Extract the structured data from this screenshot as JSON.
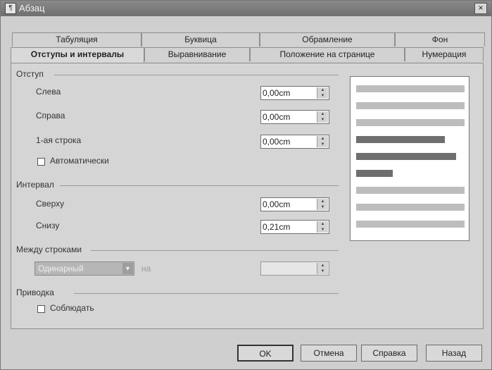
{
  "window": {
    "title": "Абзац",
    "close_glyph": "×"
  },
  "tabs_top": [
    {
      "label": "Табуляция"
    },
    {
      "label": "Буквица"
    },
    {
      "label": "Обрамление"
    },
    {
      "label": "Фон"
    }
  ],
  "tabs_bottom": [
    {
      "label": "Отступы и интервалы"
    },
    {
      "label": "Выравнивание"
    },
    {
      "label": "Положение на странице"
    },
    {
      "label": "Нумерация"
    }
  ],
  "indent": {
    "heading": "Отступ",
    "left_label": "Слева",
    "left_value": "0,00cm",
    "right_label": "Справа",
    "right_value": "0,00cm",
    "first_label": "1-ая строка",
    "first_value": "0,00cm",
    "auto_label": "Автоматически"
  },
  "spacing": {
    "heading": "Интервал",
    "above_label": "Сверху",
    "above_value": "0,00cm",
    "below_label": "Снизу",
    "below_value": "0,21cm"
  },
  "linespacing": {
    "heading": "Между строками",
    "selected": "Одинарный",
    "by_label": "на",
    "value": ""
  },
  "register": {
    "heading": "Приводка",
    "keep_label": "Соблюдать"
  },
  "buttons": {
    "ok": "OK",
    "cancel": "Отмена",
    "help": "Справка",
    "back": "Назад"
  },
  "colors": {
    "preview_light": "#bdbdbd",
    "preview_dark": "#6e6e6e"
  }
}
